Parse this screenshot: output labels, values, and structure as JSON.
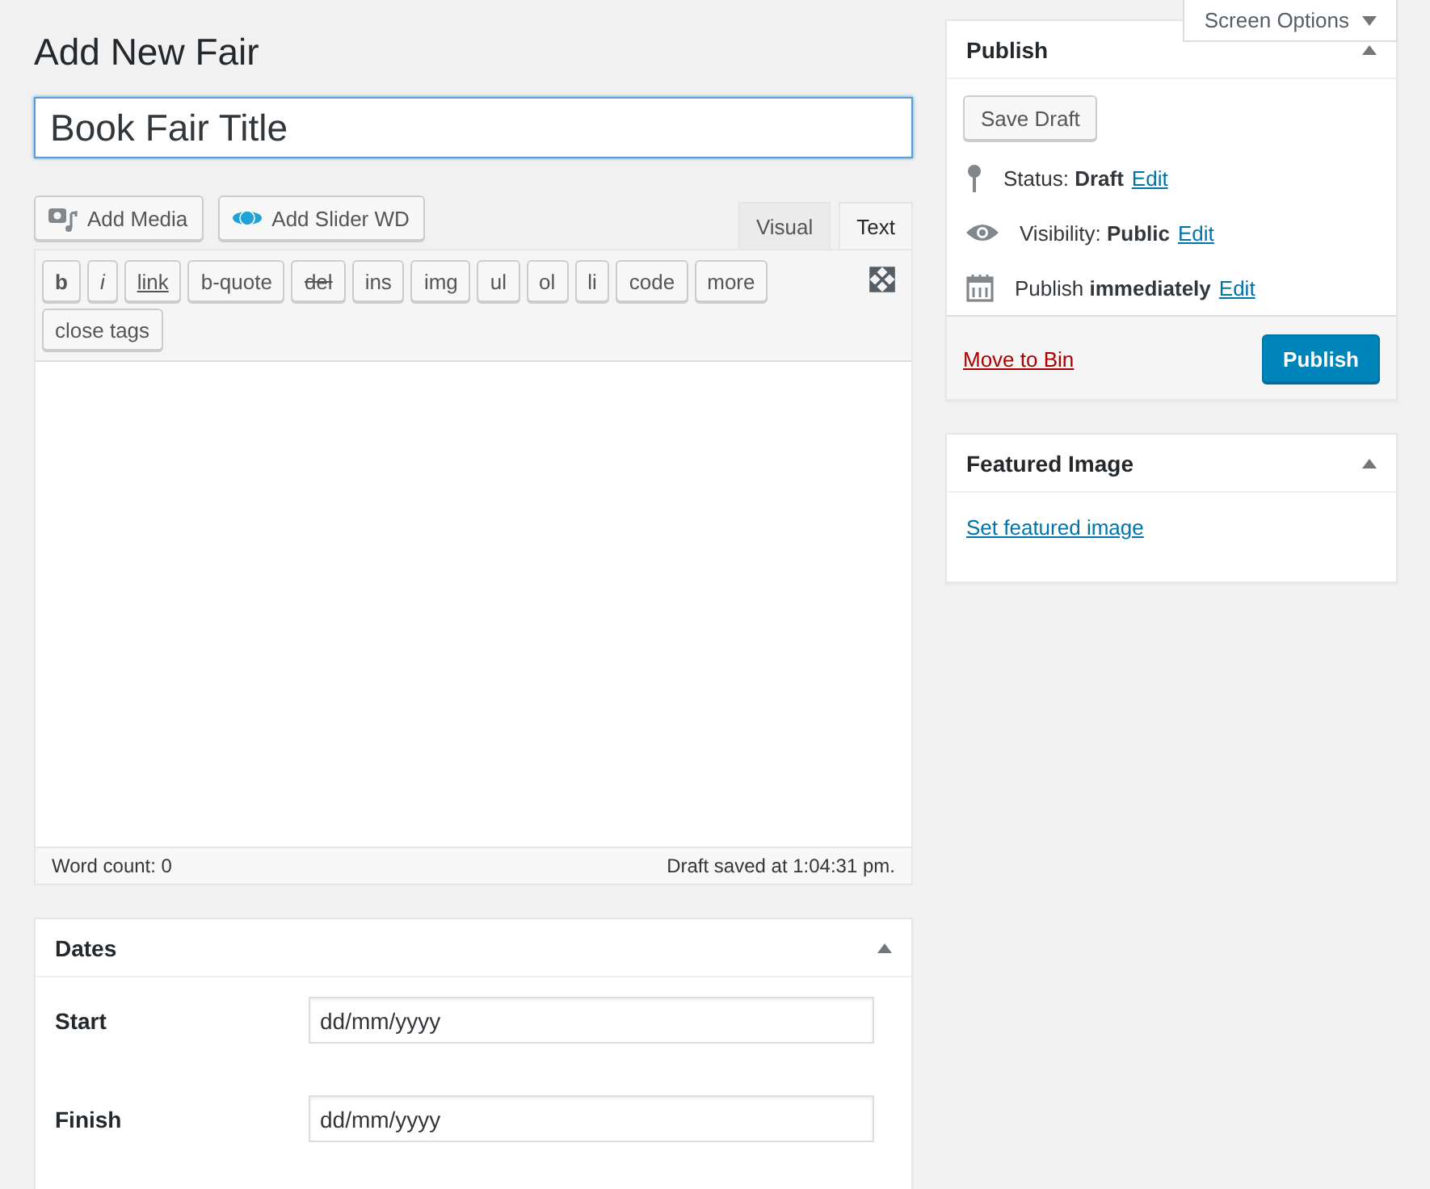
{
  "screen_options": {
    "label": "Screen Options",
    "expanded": false
  },
  "heading": "Add New Fair",
  "title_field": {
    "value": "Book Fair Title"
  },
  "media_buttons": [
    {
      "label": "Add Media",
      "kind": "media"
    },
    {
      "label": "Add Slider WD",
      "kind": "slider"
    }
  ],
  "editor_tabs": [
    {
      "label": "Visual",
      "selected": false
    },
    {
      "label": "Text",
      "selected": true
    }
  ],
  "quicktags": [
    {
      "label": "b",
      "kind": "bold"
    },
    {
      "label": "i",
      "kind": "italic"
    },
    {
      "label": "link",
      "kind": "underline"
    },
    {
      "label": "b-quote",
      "kind": "plain"
    },
    {
      "label": "del",
      "kind": "strike"
    },
    {
      "label": "ins",
      "kind": "plain"
    },
    {
      "label": "img",
      "kind": "plain"
    },
    {
      "label": "ul",
      "kind": "plain"
    },
    {
      "label": "ol",
      "kind": "plain"
    },
    {
      "label": "li",
      "kind": "plain"
    },
    {
      "label": "code",
      "kind": "plain"
    },
    {
      "label": "more",
      "kind": "plain"
    },
    {
      "label": "close tags",
      "kind": "plain"
    }
  ],
  "editor_footer": {
    "word_count": "Word count: 0",
    "saved": "Draft saved at 1:04:31 pm."
  },
  "dates_box": {
    "title": "Dates",
    "expanded": true,
    "fields": [
      {
        "label": "Start",
        "value": "dd/mm/yyyy"
      },
      {
        "label": "Finish",
        "value": "dd/mm/yyyy"
      }
    ]
  },
  "publish_box": {
    "title": "Publish",
    "expanded": true,
    "save_button": "Save Draft",
    "items": [
      {
        "kind": "pin",
        "text": "Status: **Draft**",
        "link": "Edit"
      },
      {
        "kind": "eye",
        "text": "Visibility: **Public**",
        "link": "Edit"
      },
      {
        "kind": "calendar",
        "text": "Publish **immediately**",
        "link": "Edit"
      }
    ],
    "trash_link": "Move to Bin",
    "publish_button": "Publish"
  },
  "featured_image_box": {
    "title": "Featured Image",
    "expanded": true,
    "link": "Set featured image"
  }
}
